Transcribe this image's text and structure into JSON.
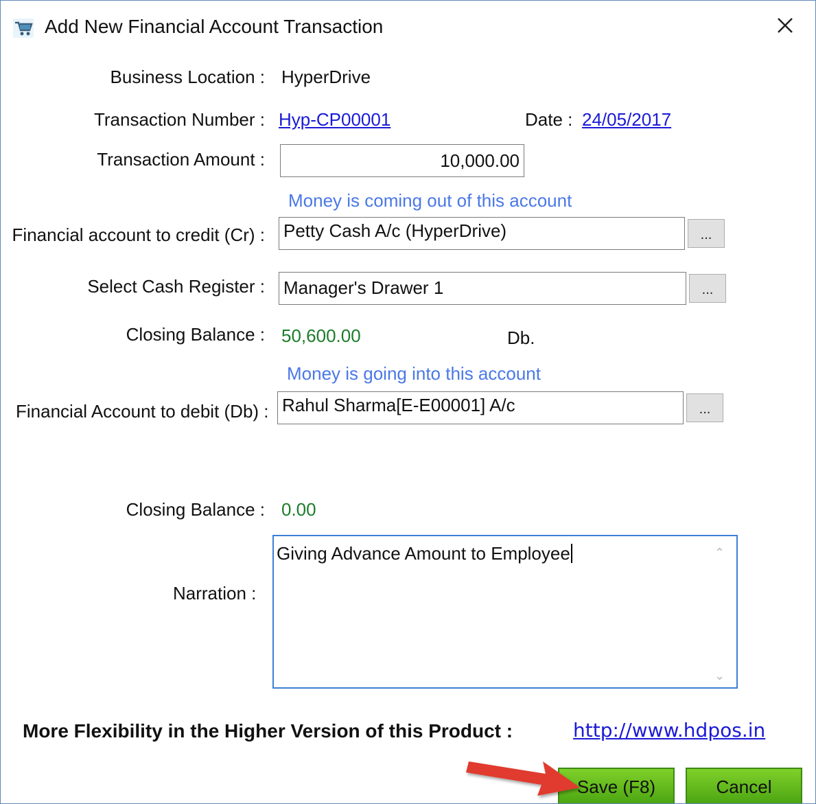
{
  "window": {
    "title": "Add New Financial Account Transaction",
    "close_glyph": "✕"
  },
  "form": {
    "business_location_label": "Business Location :",
    "business_location_value": "HyperDrive",
    "transaction_number_label": "Transaction Number :",
    "transaction_number_value": "Hyp-CP00001",
    "date_label": "Date :",
    "date_value": "24/05/2017",
    "transaction_amount_label": "Transaction Amount :",
    "transaction_amount_value": "10,000.00",
    "credit_hint": "Money is coming out of this account",
    "credit_account_label": "Financial account  to credit (Cr) :",
    "credit_account_value": "Petty Cash A/c (HyperDrive)",
    "cash_register_label": "Select Cash Register :",
    "cash_register_value": "Manager's Drawer 1",
    "closing_balance_label": "Closing Balance :",
    "credit_closing_balance": "50,600.00",
    "credit_balance_type": "Db.",
    "debit_hint": "Money is going into this account",
    "debit_account_label": "Financial Account to debit (Db)  :",
    "debit_account_value": "Rahul Sharma[E-E00001] A/c",
    "debit_closing_balance": "0.00",
    "narration_label": "Narration :",
    "narration_value": "Giving Advance Amount to Employee",
    "browse_label": "..."
  },
  "footer": {
    "promo_text": "More Flexibility in the Higher Version of this Product :",
    "promo_link": "http://www.hdpos.in",
    "save_label": "Save (F8)",
    "cancel_label": "Cancel"
  },
  "colors": {
    "link": "#1a1ad6",
    "hint": "#4a78e6",
    "balance": "#1b7d2a",
    "button": "#5cb81a",
    "arrow": "#e03a2e"
  },
  "icons": {
    "app": "shopping-cart-icon",
    "close": "close-icon",
    "annotation": "red-arrow-icon"
  }
}
